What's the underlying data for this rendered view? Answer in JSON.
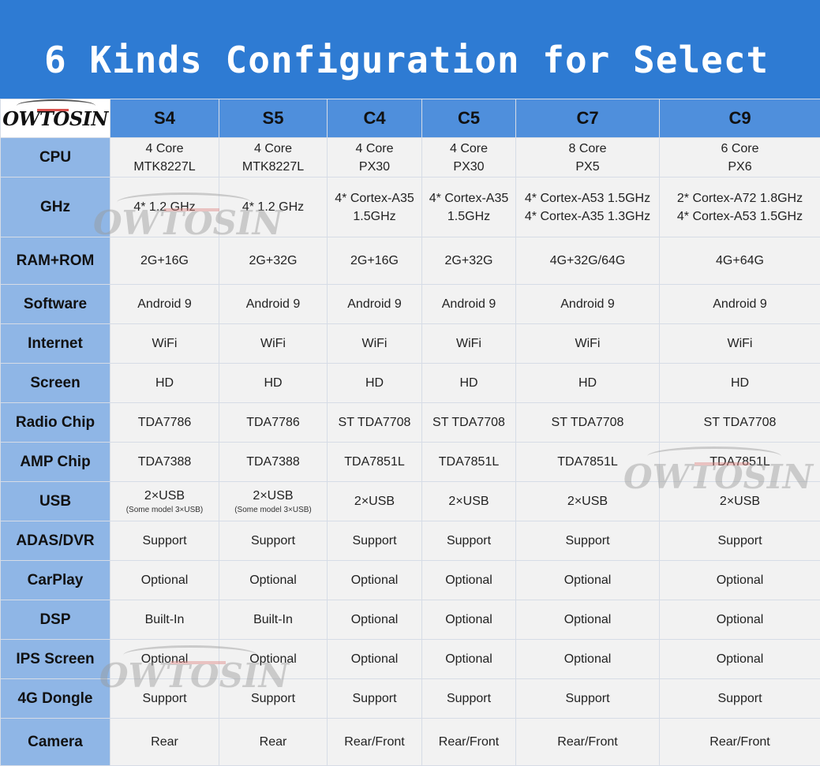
{
  "banner": {
    "title": "6 Kinds Configuration for Select"
  },
  "brand": {
    "logo_text": "OWTOSIN",
    "watermark_text": "OWTOSIN"
  },
  "columns": [
    "S4",
    "S5",
    "C4",
    "C5",
    "C7",
    "C9"
  ],
  "rows": [
    {
      "label": "CPU",
      "cells": [
        [
          "4 Core",
          "MTK8227L"
        ],
        [
          "4 Core",
          "MTK8227L"
        ],
        [
          "4 Core",
          "PX30"
        ],
        [
          "4 Core",
          "PX30"
        ],
        [
          "8 Core",
          "PX5"
        ],
        [
          "6 Core",
          "PX6"
        ]
      ]
    },
    {
      "label": "GHz",
      "cells": [
        [
          "4* 1.2 GHz"
        ],
        [
          "4* 1.2 GHz"
        ],
        [
          "4* Cortex-A35",
          "1.5GHz"
        ],
        [
          "4* Cortex-A35",
          "1.5GHz"
        ],
        [
          "4* Cortex-A53 1.5GHz",
          "4* Cortex-A35 1.3GHz"
        ],
        [
          "2* Cortex-A72 1.8GHz",
          "4* Cortex-A53 1.5GHz"
        ]
      ]
    },
    {
      "label": "RAM+ROM",
      "cells": [
        [
          "2G+16G"
        ],
        [
          "2G+32G"
        ],
        [
          "2G+16G"
        ],
        [
          "2G+32G"
        ],
        [
          "4G+32G/64G"
        ],
        [
          "4G+64G"
        ]
      ]
    },
    {
      "label": "Software",
      "cells": [
        [
          "Android 9"
        ],
        [
          "Android 9"
        ],
        [
          "Android 9"
        ],
        [
          "Android 9"
        ],
        [
          "Android 9"
        ],
        [
          "Android 9"
        ]
      ]
    },
    {
      "label": "Internet",
      "cells": [
        [
          "WiFi"
        ],
        [
          "WiFi"
        ],
        [
          "WiFi"
        ],
        [
          "WiFi"
        ],
        [
          "WiFi"
        ],
        [
          "WiFi"
        ]
      ]
    },
    {
      "label": "Screen",
      "cells": [
        [
          "HD"
        ],
        [
          "HD"
        ],
        [
          "HD"
        ],
        [
          "HD"
        ],
        [
          "HD"
        ],
        [
          "HD"
        ]
      ]
    },
    {
      "label": "Radio Chip",
      "cells": [
        [
          "TDA7786"
        ],
        [
          "TDA7786"
        ],
        [
          "ST TDA7708"
        ],
        [
          "ST TDA7708"
        ],
        [
          "ST TDA7708"
        ],
        [
          "ST TDA7708"
        ]
      ]
    },
    {
      "label": "AMP Chip",
      "cells": [
        [
          "TDA7388"
        ],
        [
          "TDA7388"
        ],
        [
          "TDA7851L"
        ],
        [
          "TDA7851L"
        ],
        [
          "TDA7851L"
        ],
        [
          "TDA7851L"
        ]
      ]
    },
    {
      "label": "USB",
      "cells": [
        [
          "2×USB"
        ],
        [
          "2×USB"
        ],
        [
          "2×USB"
        ],
        [
          "2×USB"
        ],
        [
          "2×USB"
        ],
        [
          "2×USB"
        ]
      ],
      "notes": [
        "(Some model 3×USB)",
        "(Some model 3×USB)",
        "",
        "",
        "",
        ""
      ]
    },
    {
      "label": "ADAS/DVR",
      "cells": [
        [
          "Support"
        ],
        [
          "Support"
        ],
        [
          "Support"
        ],
        [
          "Support"
        ],
        [
          "Support"
        ],
        [
          "Support"
        ]
      ]
    },
    {
      "label": "CarPlay",
      "cells": [
        [
          "Optional"
        ],
        [
          "Optional"
        ],
        [
          "Optional"
        ],
        [
          "Optional"
        ],
        [
          "Optional"
        ],
        [
          "Optional"
        ]
      ]
    },
    {
      "label": "DSP",
      "cells": [
        [
          "Built-In"
        ],
        [
          "Built-In"
        ],
        [
          "Optional"
        ],
        [
          "Optional"
        ],
        [
          "Optional"
        ],
        [
          "Optional"
        ]
      ]
    },
    {
      "label": "IPS Screen",
      "cells": [
        [
          "Optional"
        ],
        [
          "Optional"
        ],
        [
          "Optional"
        ],
        [
          "Optional"
        ],
        [
          "Optional"
        ],
        [
          "Optional"
        ]
      ]
    },
    {
      "label": "4G Dongle",
      "cells": [
        [
          "Support"
        ],
        [
          "Support"
        ],
        [
          "Support"
        ],
        [
          "Support"
        ],
        [
          "Support"
        ],
        [
          "Support"
        ]
      ]
    },
    {
      "label": "Camera",
      "cells": [
        [
          "Rear"
        ],
        [
          "Rear"
        ],
        [
          "Rear/Front"
        ],
        [
          "Rear/Front"
        ],
        [
          "Rear/Front"
        ],
        [
          "Rear/Front"
        ]
      ]
    }
  ]
}
